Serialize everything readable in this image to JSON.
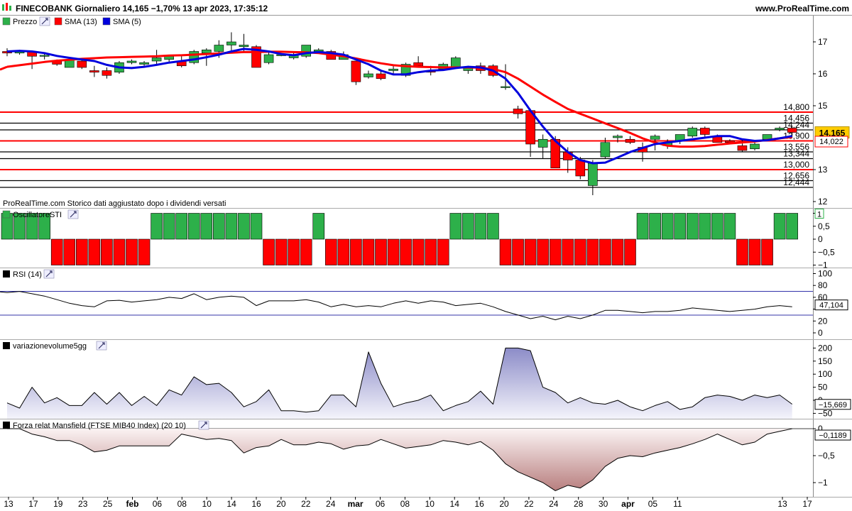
{
  "header": {
    "title": "FINECOBANK Giornaliero 14,165 −1,70% 13 apr 2023, 17:35:12",
    "site": "www.ProRealTime.com"
  },
  "panels": {
    "price": {
      "legend": [
        "Prezzo",
        "SMA (13)",
        "SMA (5)"
      ],
      "note": "ProRealTime.com  Storico dati aggiustato dopo i dividendi versati"
    },
    "sti": {
      "legend": "OscillatoreSTI"
    },
    "rsi": {
      "legend": "RSI (14)"
    },
    "vol": {
      "legend": "variazionevolume5gg"
    },
    "mansfield": {
      "legend": "Forza relat Mansfield (FTSE MIB40 Index) (20 10)"
    }
  },
  "colors": {
    "up": "#2db04a",
    "down": "#ff0000",
    "sma13": "#ff0000",
    "sma5": "#0000dd",
    "level_red": "#ff0000",
    "level_black": "#000000",
    "vol_fill": "#c9c9e8",
    "mans_fill": "#e6c8c8",
    "rsi_band": "#3333aa"
  },
  "chart_data": [
    {
      "type": "candlestick",
      "name": "Prezzo",
      "x_ticks": [
        "13",
        "17",
        "19",
        "23",
        "25",
        "feb",
        "06",
        "08",
        "10",
        "14",
        "16",
        "20",
        "22",
        "24",
        "mar",
        "06",
        "08",
        "10",
        "14",
        "16",
        "20",
        "22",
        "24",
        "28",
        "30",
        "apr",
        "05",
        "11",
        "13",
        "17"
      ],
      "y_ticks": [
        "17",
        "16",
        "15",
        "13",
        "12"
      ],
      "ylim": [
        12.1,
        17.7
      ],
      "last_price_label": "14,165",
      "sma13_label": "14,022",
      "levels": [
        {
          "value": 14.8,
          "label": "14,800",
          "color": "red"
        },
        {
          "value": 14.456,
          "label": "14,456",
          "color": "black"
        },
        {
          "value": 14.244,
          "label": "14,244",
          "color": "black"
        },
        {
          "value": 13.9,
          "label": "13,900",
          "color": "red"
        },
        {
          "value": 13.556,
          "label": "13,556",
          "color": "black"
        },
        {
          "value": 13.344,
          "label": "13,344",
          "color": "black"
        },
        {
          "value": 13.0,
          "label": "13,000",
          "color": "red"
        },
        {
          "value": 12.656,
          "label": "12,656",
          "color": "black"
        },
        {
          "value": 12.444,
          "label": "12,444",
          "color": "black"
        }
      ],
      "candles": [
        [
          16.7,
          16.8,
          16.55,
          16.65
        ],
        [
          16.65,
          16.75,
          16.6,
          16.7
        ],
        [
          16.7,
          16.72,
          16.15,
          16.55
        ],
        [
          16.55,
          16.65,
          16.45,
          16.58
        ],
        [
          16.4,
          16.45,
          16.25,
          16.3
        ],
        [
          16.2,
          16.45,
          16.2,
          16.45
        ],
        [
          16.4,
          16.5,
          16.15,
          16.2
        ],
        [
          16.1,
          16.25,
          15.9,
          16.05
        ],
        [
          16.1,
          16.2,
          15.85,
          15.95
        ],
        [
          16.05,
          16.4,
          16.0,
          16.35
        ],
        [
          16.35,
          16.45,
          16.3,
          16.4
        ],
        [
          16.3,
          16.4,
          16.25,
          16.35
        ],
        [
          16.4,
          16.75,
          16.3,
          16.5
        ],
        [
          16.45,
          16.6,
          16.35,
          16.55
        ],
        [
          16.4,
          16.55,
          16.2,
          16.25
        ],
        [
          16.35,
          16.75,
          16.3,
          16.7
        ],
        [
          16.65,
          16.8,
          16.25,
          16.75
        ],
        [
          16.7,
          17.05,
          16.5,
          16.9
        ],
        [
          16.9,
          17.3,
          16.7,
          17.0
        ],
        [
          16.85,
          17.25,
          16.7,
          16.9
        ],
        [
          16.85,
          16.9,
          16.2,
          16.2
        ],
        [
          16.35,
          16.7,
          16.3,
          16.6
        ],
        [
          16.6,
          16.65,
          16.55,
          16.6
        ],
        [
          16.5,
          16.7,
          16.45,
          16.6
        ],
        [
          16.55,
          16.9,
          16.5,
          16.9
        ],
        [
          16.7,
          16.8,
          16.65,
          16.75
        ],
        [
          16.7,
          16.75,
          16.45,
          16.45
        ],
        [
          16.45,
          16.7,
          16.45,
          16.6
        ],
        [
          16.4,
          16.4,
          15.65,
          15.75
        ],
        [
          15.9,
          16.1,
          15.85,
          16.0
        ],
        [
          16.0,
          16.1,
          15.8,
          15.85
        ],
        [
          16.1,
          16.25,
          16.0,
          16.15
        ],
        [
          15.95,
          16.35,
          15.9,
          16.3
        ],
        [
          16.35,
          16.55,
          16.2,
          16.25
        ],
        [
          16.1,
          16.25,
          15.95,
          16.05
        ],
        [
          16.15,
          16.35,
          16.1,
          16.3
        ],
        [
          16.2,
          16.55,
          16.15,
          16.5
        ],
        [
          16.1,
          16.25,
          16.0,
          16.2
        ],
        [
          16.25,
          16.35,
          16.0,
          16.1
        ],
        [
          16.25,
          16.3,
          15.9,
          15.95
        ],
        [
          15.6,
          16.3,
          15.5,
          15.6
        ],
        [
          14.9,
          15.0,
          14.6,
          14.75
        ],
        [
          14.85,
          14.9,
          13.4,
          13.8
        ],
        [
          13.7,
          14.1,
          13.35,
          13.95
        ],
        [
          13.95,
          14.05,
          13.05,
          13.05
        ],
        [
          13.55,
          13.7,
          12.9,
          13.3
        ],
        [
          13.3,
          13.4,
          12.7,
          12.8
        ],
        [
          12.5,
          13.3,
          12.2,
          13.2
        ],
        [
          13.4,
          14.0,
          13.35,
          13.85
        ],
        [
          14.0,
          14.1,
          13.85,
          14.05
        ],
        [
          13.95,
          14.05,
          13.8,
          13.85
        ],
        [
          13.7,
          13.85,
          13.25,
          13.55
        ],
        [
          13.95,
          14.1,
          13.6,
          14.05
        ],
        [
          13.75,
          13.95,
          13.65,
          13.85
        ],
        [
          13.9,
          14.1,
          13.8,
          14.1
        ],
        [
          14.05,
          14.35,
          14.0,
          14.3
        ],
        [
          14.3,
          14.35,
          14.0,
          14.1
        ],
        [
          14.05,
          14.1,
          13.85,
          13.85
        ],
        [
          13.9,
          13.95,
          13.8,
          13.85
        ],
        [
          13.75,
          13.95,
          13.55,
          13.6
        ],
        [
          13.65,
          13.85,
          13.6,
          13.8
        ],
        [
          13.95,
          14.1,
          13.9,
          14.1
        ],
        [
          14.25,
          14.35,
          14.2,
          14.3
        ],
        [
          14.3,
          14.35,
          14.05,
          14.165
        ]
      ],
      "sma13": [
        16.22,
        16.27,
        16.32,
        16.37,
        16.41,
        16.44,
        16.47,
        16.49,
        16.51,
        16.52,
        16.53,
        16.54,
        16.55,
        16.57,
        16.58,
        16.6,
        16.62,
        16.64,
        16.66,
        16.68,
        16.68,
        16.69,
        16.69,
        16.68,
        16.67,
        16.65,
        16.6,
        16.55,
        16.48,
        16.4,
        16.33,
        16.27,
        16.24,
        16.22,
        16.21,
        16.2,
        16.2,
        16.2,
        16.19,
        16.15,
        16.05,
        15.85,
        15.6,
        15.35,
        15.12,
        14.9,
        14.75,
        14.6,
        14.45,
        14.3,
        14.15,
        13.98,
        13.85,
        13.75,
        13.72,
        13.72,
        13.74,
        13.78,
        13.82,
        13.85,
        13.88,
        13.93,
        13.98,
        14.02
      ],
      "sma5": [
        16.7,
        16.72,
        16.7,
        16.65,
        16.56,
        16.5,
        16.45,
        16.4,
        16.28,
        16.2,
        16.18,
        16.22,
        16.28,
        16.35,
        16.4,
        16.45,
        16.52,
        16.6,
        16.7,
        16.78,
        16.75,
        16.7,
        16.62,
        16.58,
        16.65,
        16.68,
        16.65,
        16.6,
        16.45,
        16.3,
        16.1,
        15.98,
        15.98,
        16.05,
        16.1,
        16.12,
        16.18,
        16.22,
        16.2,
        16.1,
        15.85,
        15.4,
        14.85,
        14.35,
        13.9,
        13.55,
        13.3,
        13.2,
        13.22,
        13.38,
        13.55,
        13.68,
        13.8,
        13.85,
        13.9,
        13.95,
        14.0,
        14.05,
        14.05,
        13.95,
        13.9,
        13.92,
        13.98,
        14.05
      ]
    },
    {
      "type": "bar",
      "name": "OscillatoreSTI",
      "y_ticks": [
        "1",
        "0,5",
        "0",
        "−0,5",
        "−1"
      ],
      "ylim": [
        -1.15,
        1.15
      ],
      "last_label": "1",
      "values": [
        1,
        1,
        1,
        1,
        -1,
        -1,
        -1,
        -1,
        -1,
        -1,
        -1,
        -1,
        1,
        1,
        1,
        1,
        1,
        1,
        1,
        1,
        1,
        -1,
        -1,
        -1,
        -1,
        1,
        -1,
        -1,
        -1,
        -1,
        -1,
        -1,
        -1,
        -1,
        -1,
        -1,
        1,
        1,
        1,
        1,
        -1,
        -1,
        -1,
        -1,
        -1,
        -1,
        -1,
        -1,
        -1,
        -1,
        -1,
        1,
        1,
        1,
        1,
        1,
        1,
        1,
        1,
        -1,
        -1,
        -1,
        1,
        1
      ]
    },
    {
      "type": "line",
      "name": "RSI (14)",
      "y_ticks": [
        "100",
        "80",
        "60",
        "40",
        "20",
        "0"
      ],
      "ylim": [
        0,
        100
      ],
      "bands": [
        70,
        30
      ],
      "last_label": "47,104",
      "values": [
        68,
        70,
        66,
        62,
        56,
        50,
        46,
        44,
        54,
        55,
        52,
        54,
        56,
        60,
        58,
        66,
        56,
        60,
        62,
        60,
        46,
        54,
        54,
        54,
        56,
        52,
        44,
        48,
        44,
        46,
        44,
        50,
        54,
        50,
        54,
        52,
        46,
        48,
        50,
        44,
        36,
        30,
        24,
        28,
        22,
        28,
        24,
        30,
        38,
        38,
        36,
        34,
        36,
        36,
        38,
        42,
        40,
        38,
        36,
        38,
        40,
        44,
        46,
        44
      ]
    },
    {
      "type": "area",
      "name": "variazionevolume5gg",
      "y_ticks": [
        "200",
        "150",
        "100",
        "50",
        "0",
        "−50"
      ],
      "ylim": [
        -55,
        215
      ],
      "last_label": "−15,669",
      "values": [
        -10,
        -30,
        50,
        -10,
        10,
        -20,
        -20,
        30,
        -15,
        30,
        -20,
        15,
        -20,
        40,
        20,
        90,
        60,
        65,
        30,
        -25,
        -5,
        40,
        -40,
        -40,
        -45,
        -40,
        20,
        20,
        -25,
        185,
        65,
        -25,
        -10,
        0,
        20,
        -40,
        -20,
        -5,
        35,
        -15,
        200,
        200,
        190,
        50,
        30,
        -10,
        10,
        -10,
        -15,
        0,
        -25,
        -40,
        -20,
        -5,
        -35,
        -25,
        10,
        20,
        15,
        0,
        20,
        10,
        20,
        -15
      ]
    },
    {
      "type": "area",
      "name": "Forza relat Mansfield (FTSE MIB40 Index) (20 10)",
      "y_ticks": [
        "0",
        "−0,5",
        "−1"
      ],
      "ylim": [
        -1.2,
        0.05
      ],
      "last_label": "−0,1189",
      "values": [
        0.0,
        0.0,
        -0.1,
        -0.15,
        -0.22,
        -0.22,
        -0.3,
        -0.43,
        -0.4,
        -0.32,
        -0.32,
        -0.32,
        -0.32,
        -0.32,
        -0.1,
        -0.15,
        -0.2,
        -0.18,
        -0.22,
        -0.45,
        -0.35,
        -0.32,
        -0.2,
        -0.3,
        -0.3,
        -0.25,
        -0.28,
        -0.38,
        -0.32,
        -0.3,
        -0.2,
        -0.28,
        -0.36,
        -0.33,
        -0.3,
        -0.22,
        -0.25,
        -0.3,
        -0.24,
        -0.4,
        -0.65,
        -0.8,
        -0.9,
        -1.0,
        -1.15,
        -1.05,
        -1.1,
        -0.95,
        -0.7,
        -0.55,
        -0.5,
        -0.52,
        -0.45,
        -0.4,
        -0.35,
        -0.28,
        -0.2,
        -0.1,
        -0.2,
        -0.3,
        -0.25,
        -0.1,
        -0.05,
        0.0
      ]
    }
  ]
}
